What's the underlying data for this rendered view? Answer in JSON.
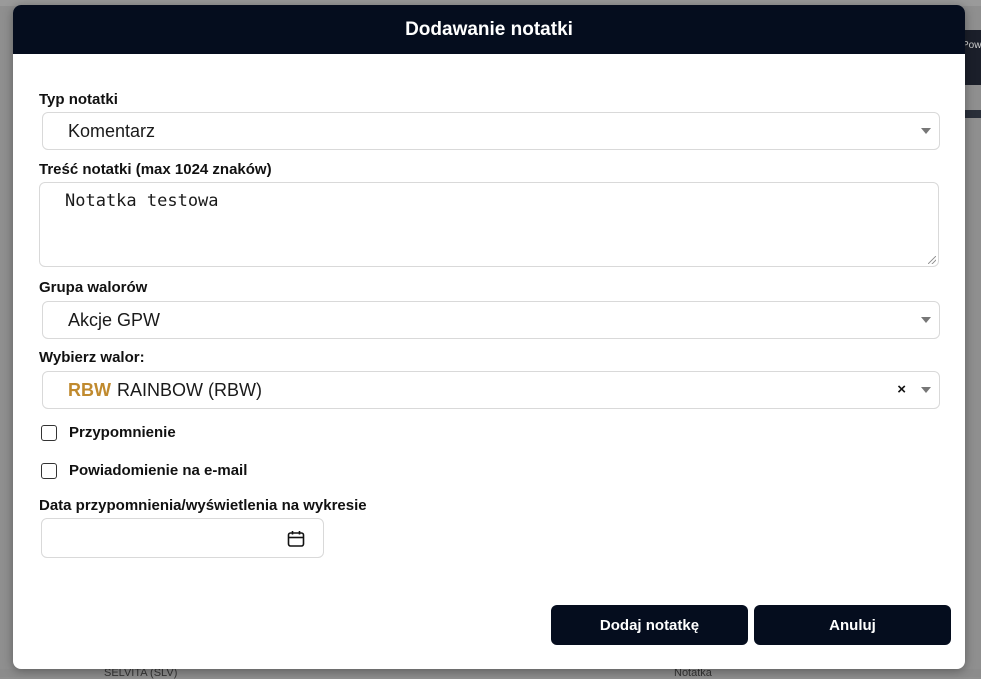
{
  "background": {
    "right_text": "Pow",
    "bottom_texts": [
      "SELVITA (SLV)",
      "Notatka"
    ]
  },
  "modal": {
    "title": "Dodawanie notatki"
  },
  "note_type": {
    "label": "Typ notatki",
    "value": "Komentarz"
  },
  "note_content": {
    "label": "Treść notatki (max 1024 znaków)",
    "value": "Notatka testowa"
  },
  "asset_group": {
    "label": "Grupa walorów",
    "value": "Akcje GPW"
  },
  "asset": {
    "label": "Wybierz walor:",
    "ticker": "RBW",
    "name": "RAINBOW (RBW)",
    "clear": "×",
    "ticker_color": "#c08a2e"
  },
  "options": {
    "reminder_label": "Przypomnienie",
    "email_label": "Powiadomienie na e-mail"
  },
  "date": {
    "label": "Data przypomnienia/wyświetlenia na wykresie",
    "value": ""
  },
  "buttons": {
    "add": "Dodaj notatkę",
    "cancel": "Anuluj"
  },
  "colors": {
    "header_bg": "#050d1e",
    "button_bg": "#050d1e"
  }
}
